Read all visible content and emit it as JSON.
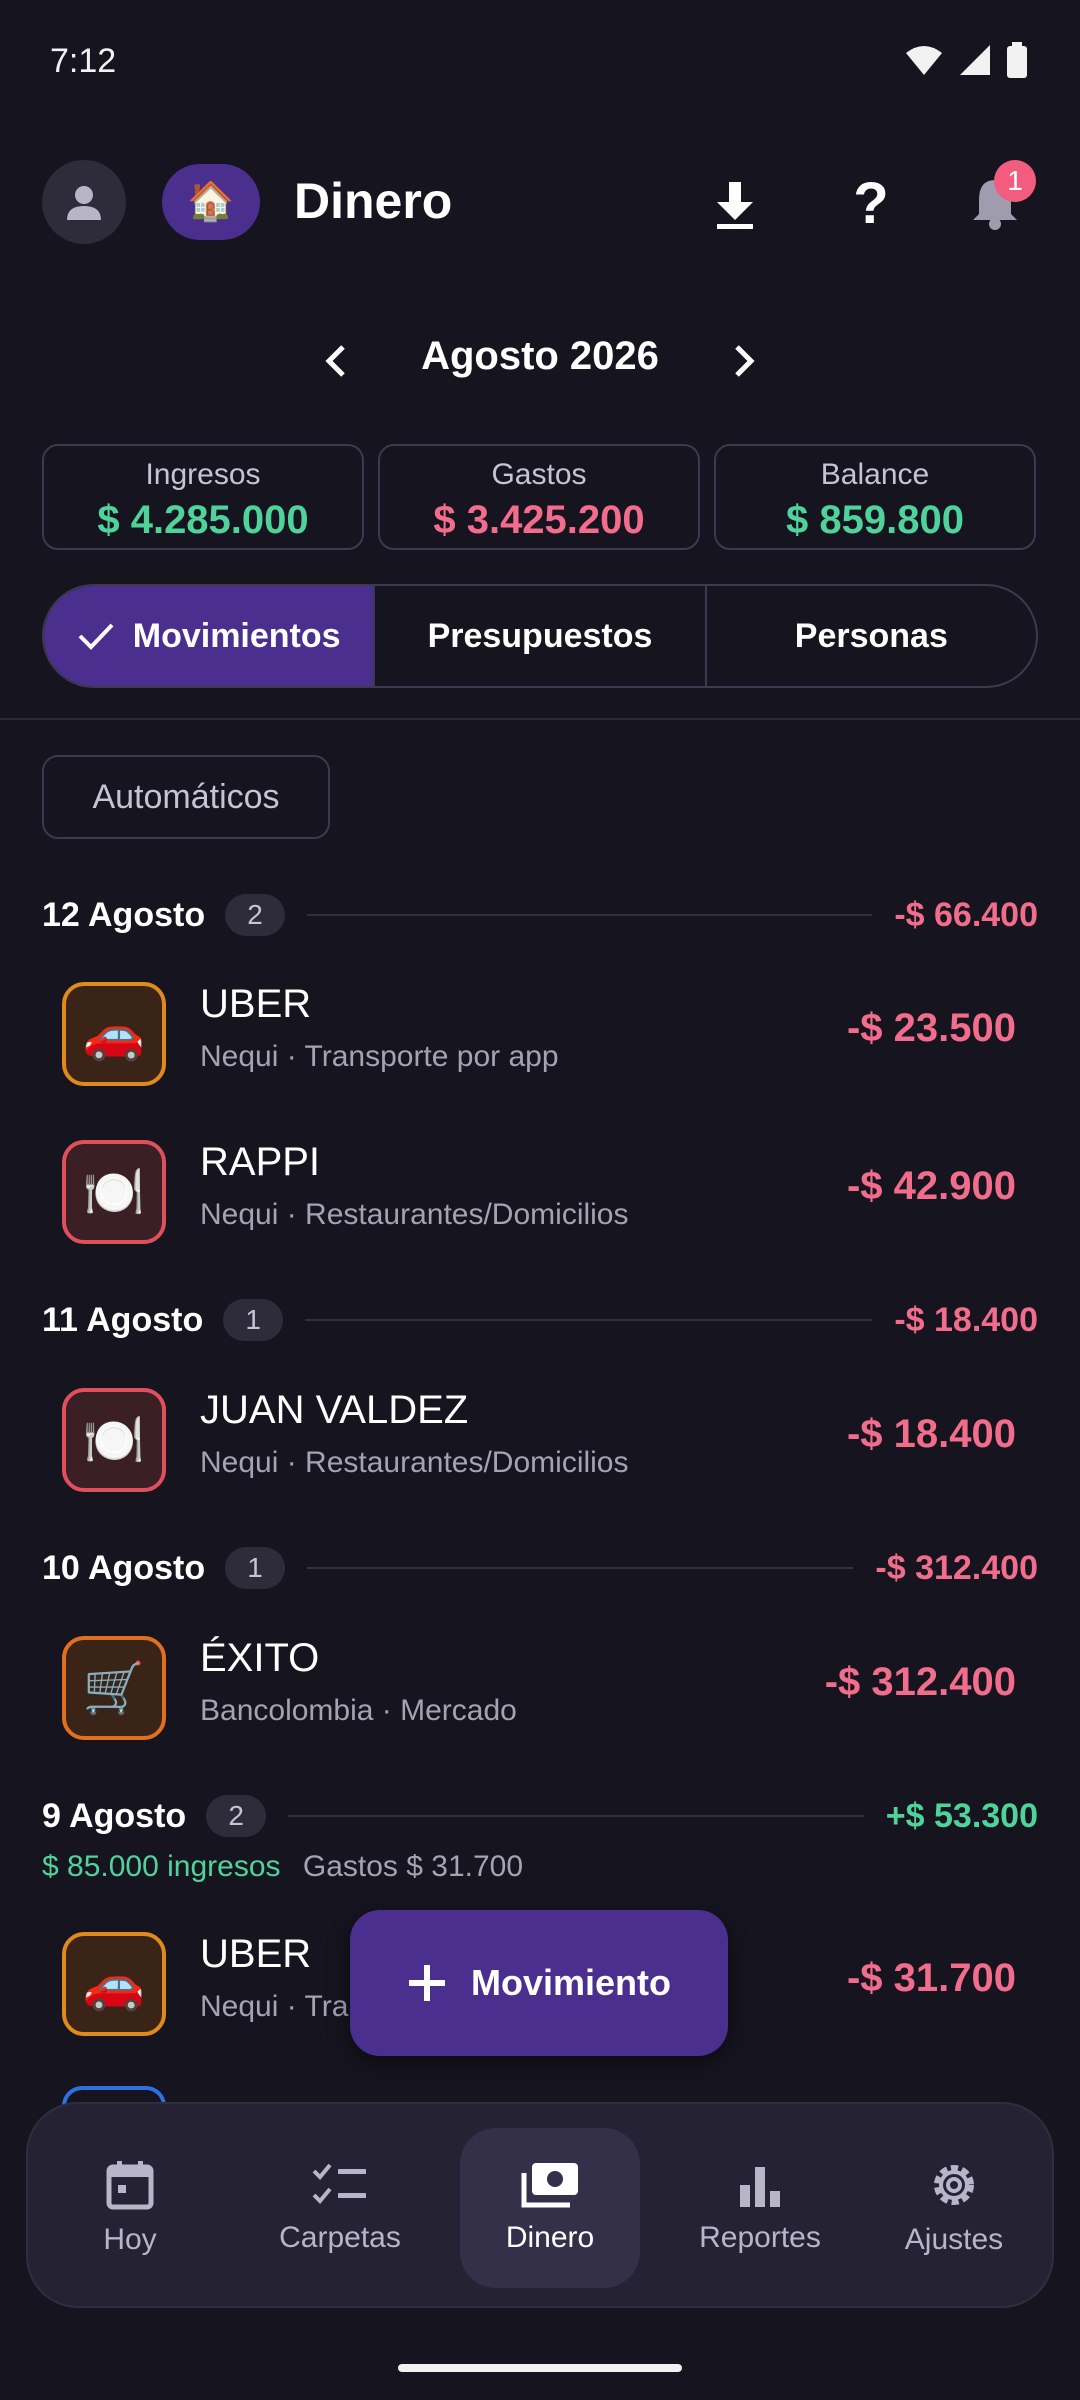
{
  "status_bar": {
    "time": "7:12"
  },
  "header": {
    "title": "Dinero",
    "home_emoji": "🏠",
    "notification_count": "1",
    "help_symbol": "?"
  },
  "month": {
    "label": "Agosto 2026"
  },
  "summary": {
    "income_label": "Ingresos",
    "income_value": "$ 4.285.000",
    "expense_label": "Gastos",
    "expense_value": "$ 3.425.200",
    "balance_label": "Balance",
    "balance_value": "$ 859.800"
  },
  "tabs": [
    {
      "label": "Movimientos",
      "active": true
    },
    {
      "label": "Presupuestos",
      "active": false
    },
    {
      "label": "Personas",
      "active": false
    }
  ],
  "filter_chip": "Automáticos",
  "days": [
    {
      "date": "12 Agosto",
      "count": "2",
      "total": "-$ 66.400"
    },
    {
      "date": "11 Agosto",
      "count": "1",
      "total": "-$ 18.400"
    },
    {
      "date": "10 Agosto",
      "count": "1",
      "total": "-$ 312.400"
    },
    {
      "date": "9 Agosto",
      "count": "2",
      "total": "+$ 53.300",
      "income_note": "$ 85.000 ingresos",
      "expense_note": "Gastos $ 31.700"
    }
  ],
  "transactions": [
    {
      "name": "UBER",
      "detail": "Nequi · Transporte por app",
      "amount": "-$ 23.500",
      "emoji": "🚗",
      "color": "#e08a1e"
    },
    {
      "name": "RAPPI",
      "detail": "Nequi · Restaurantes/Domicilios",
      "amount": "-$ 42.900",
      "emoji": "🍽️",
      "color": "#e0505a"
    },
    {
      "name": "JUAN VALDEZ",
      "detail": "Nequi · Restaurantes/Domicilios",
      "amount": "-$ 18.400",
      "emoji": "🍽️",
      "color": "#e0505a"
    },
    {
      "name": "ÉXITO",
      "detail": "Bancolombia · Mercado",
      "amount": "-$ 312.400",
      "emoji": "🛒",
      "color": "#e0701e"
    },
    {
      "name": "UBER",
      "detail": "Nequi · Tra",
      "amount": "-$ 31.700",
      "emoji": "🚗",
      "color": "#e08a1e"
    }
  ],
  "fab": {
    "label": "Movimiento"
  },
  "bottom_nav": [
    {
      "label": "Hoy",
      "icon": "calendar-icon",
      "active": false
    },
    {
      "label": "Carpetas",
      "icon": "checklist-icon",
      "active": false
    },
    {
      "label": "Dinero",
      "icon": "money-icon",
      "active": true
    },
    {
      "label": "Reportes",
      "icon": "bar-chart-icon",
      "active": false
    },
    {
      "label": "Ajustes",
      "icon": "gear-icon",
      "active": false
    }
  ],
  "colors": {
    "accent": "#4a2f8f",
    "income": "#4fd39b",
    "expense": "#f26d8c",
    "background": "#16141f"
  }
}
